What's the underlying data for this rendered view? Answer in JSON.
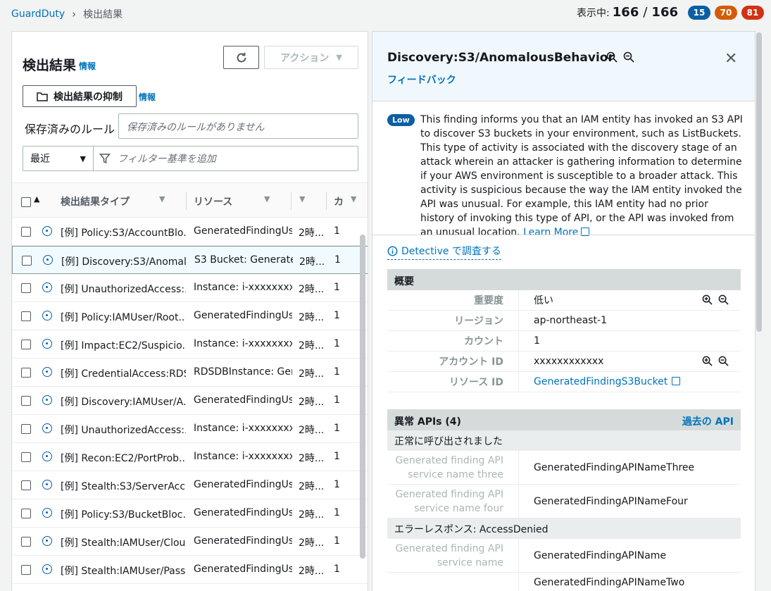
{
  "breadcrumb": {
    "root": "GuardDuty",
    "current": "検出結果"
  },
  "counts": {
    "label": "表示中:",
    "shown": "166",
    "total": "166",
    "low": "15",
    "medium": "70",
    "high": "81"
  },
  "left": {
    "title": "検出結果",
    "info": "情報",
    "action_label": "アクション",
    "suppress_label": "検出結果の抑制",
    "suppress_info": "情報",
    "saved_rules_label": "保存済みのルール",
    "saved_rules_placeholder": "保存済みのルールがありません",
    "recent_label": "最近",
    "filter_placeholder": "フィルター基準を追加",
    "columns": {
      "type": "検出結果タイプ",
      "resource": "リソース",
      "count": "カ"
    },
    "rows": [
      {
        "type": "[例] Policy:S3/AccountBlo...",
        "resource": "GeneratedFindingUser",
        "time": "2時...",
        "count": "1"
      },
      {
        "type": "[例] Discovery:S3/Anomal...",
        "resource": "S3 Bucket: GeneratedI",
        "time": "2時...",
        "count": "1"
      },
      {
        "type": "[例] UnauthorizedAccess:...",
        "resource": "Instance: i-xxxxxxxx",
        "time": "2時...",
        "count": "1"
      },
      {
        "type": "[例] Policy:IAMUser/Root...",
        "resource": "GeneratedFindingUser",
        "time": "2時...",
        "count": "1"
      },
      {
        "type": "[例] Impact:EC2/Suspicio...",
        "resource": "Instance: i-xxxxxxxx",
        "time": "2時...",
        "count": "1"
      },
      {
        "type": "[例] CredentialAccess:RDS...",
        "resource": "RDSDBInstance: Gene",
        "time": "2時...",
        "count": "1"
      },
      {
        "type": "[例] Discovery:IAMUser/A...",
        "resource": "GeneratedFindingUser",
        "time": "2時...",
        "count": "1"
      },
      {
        "type": "[例] UnauthorizedAccess:...",
        "resource": "Instance: i-xxxxxxxx",
        "time": "2時...",
        "count": "1"
      },
      {
        "type": "[例] Recon:EC2/PortProb...",
        "resource": "Instance: i-xxxxxxxx",
        "time": "2時...",
        "count": "1"
      },
      {
        "type": "[例] Stealth:S3/ServerAcc...",
        "resource": "GeneratedFindingUser",
        "time": "2時...",
        "count": "1"
      },
      {
        "type": "[例] Policy:S3/BucketBloc...",
        "resource": "GeneratedFindingUser",
        "time": "2時...",
        "count": "1"
      },
      {
        "type": "[例] Stealth:IAMUser/Clou...",
        "resource": "GeneratedFindingUser",
        "time": "2時...",
        "count": "1"
      },
      {
        "type": "[例] Stealth:IAMUser/Pass...",
        "resource": "GeneratedFindingUser",
        "time": "2時...",
        "count": "1"
      }
    ]
  },
  "detail": {
    "title": "Discovery:S3/AnomalousBehavior",
    "feedback": "フィードバック",
    "severity": "Low",
    "description": "This finding informs you that an IAM entity has invoked an S3 API to discover S3 buckets in your environment, such as ListBuckets. This type of activity is associated with the discovery stage of an attack wherein an attacker is gathering information to determine if your AWS environment is susceptible to a broader attack. This activity is suspicious because the way the IAM entity invoked the API was unusual. For example, this IAM entity had no prior history of invoking this type of API, or the API was invoked from an unusual location.",
    "learn_more": "Learn More",
    "detective": "Detective で調査する",
    "overview": {
      "title": "概要",
      "rows": [
        {
          "k": "重要度",
          "v": "低い"
        },
        {
          "k": "リージョン",
          "v": "ap-northeast-1"
        },
        {
          "k": "カウント",
          "v": "1"
        },
        {
          "k": "アカウント ID",
          "v": "xxxxxxxxxxxx"
        },
        {
          "k": "リソース ID",
          "v": "GeneratedFindingS3Bucket"
        }
      ]
    },
    "apis": {
      "title": "異常 APIs (4)",
      "past_link": "過去の API",
      "success_header": "正常に呼び出されました",
      "success_rows": [
        {
          "k": "Generated finding API service name three",
          "v": "GeneratedFindingAPINameThree"
        },
        {
          "k": "Generated finding API service name four",
          "v": "GeneratedFindingAPINameFour"
        }
      ],
      "error_header": "エラーレスポンス: AccessDenied",
      "error_rows": [
        {
          "k": "Generated finding API service name",
          "v": "GeneratedFindingAPIName"
        },
        {
          "k": "",
          "v": "GeneratedFindingAPINameTwo"
        }
      ]
    }
  },
  "colors": {
    "link": "#0073bb",
    "low": "#0b5fa5",
    "medium": "#d45b07",
    "high": "#d13212"
  }
}
